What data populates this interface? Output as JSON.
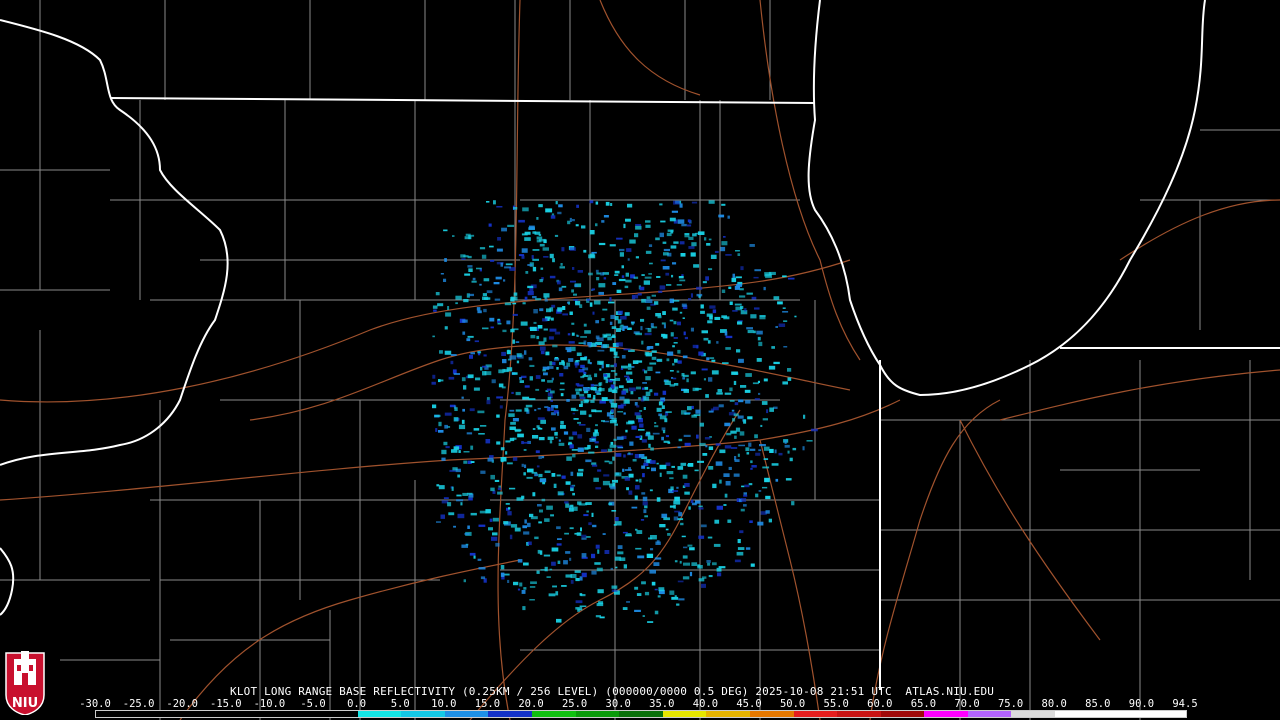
{
  "caption": "KLOT LONG RANGE BASE REFLECTIVITY (0.25KM / 256 LEVEL) (000000/0000 0.5 DEG) 2025-10-08 21:51 UTC  ATLAS.NIU.EDU",
  "scale": {
    "ticks": [
      "-30.0",
      "-25.0",
      "-20.0",
      "-15.0",
      "-10.0",
      "-5.0",
      "0.0",
      "5.0",
      "10.0",
      "15.0",
      "20.0",
      "25.0",
      "30.0",
      "35.0",
      "40.0",
      "45.0",
      "50.0",
      "55.0",
      "60.0",
      "65.0",
      "70.0",
      "75.0",
      "80.0",
      "85.0",
      "90.0",
      "94.5"
    ],
    "colors": [
      "#000000",
      "#000000",
      "#000000",
      "#000000",
      "#000000",
      "#000000",
      "#14e6e6",
      "#14c8e6",
      "#1e90e6",
      "#1432c8",
      "#10c010",
      "#0a9a0a",
      "#0a700a",
      "#e6e600",
      "#e6b400",
      "#e67800",
      "#e61e1e",
      "#c81414",
      "#a00a0a",
      "#ff00ff",
      "#b464ff",
      "#dcdcdc",
      "#ffffff",
      "#ffffff",
      "#ffffff"
    ]
  },
  "logo": {
    "text": "NIU",
    "colors": {
      "red": "#c8102e",
      "white": "#ffffff"
    }
  },
  "map_colors": {
    "state_border": "#ffffff",
    "county_border": "#8a8a8a",
    "highway": "#a0522d",
    "echo_light": "#19d2e6",
    "echo_mid": "#1e8ce6",
    "echo_dark": "#1432c8"
  }
}
